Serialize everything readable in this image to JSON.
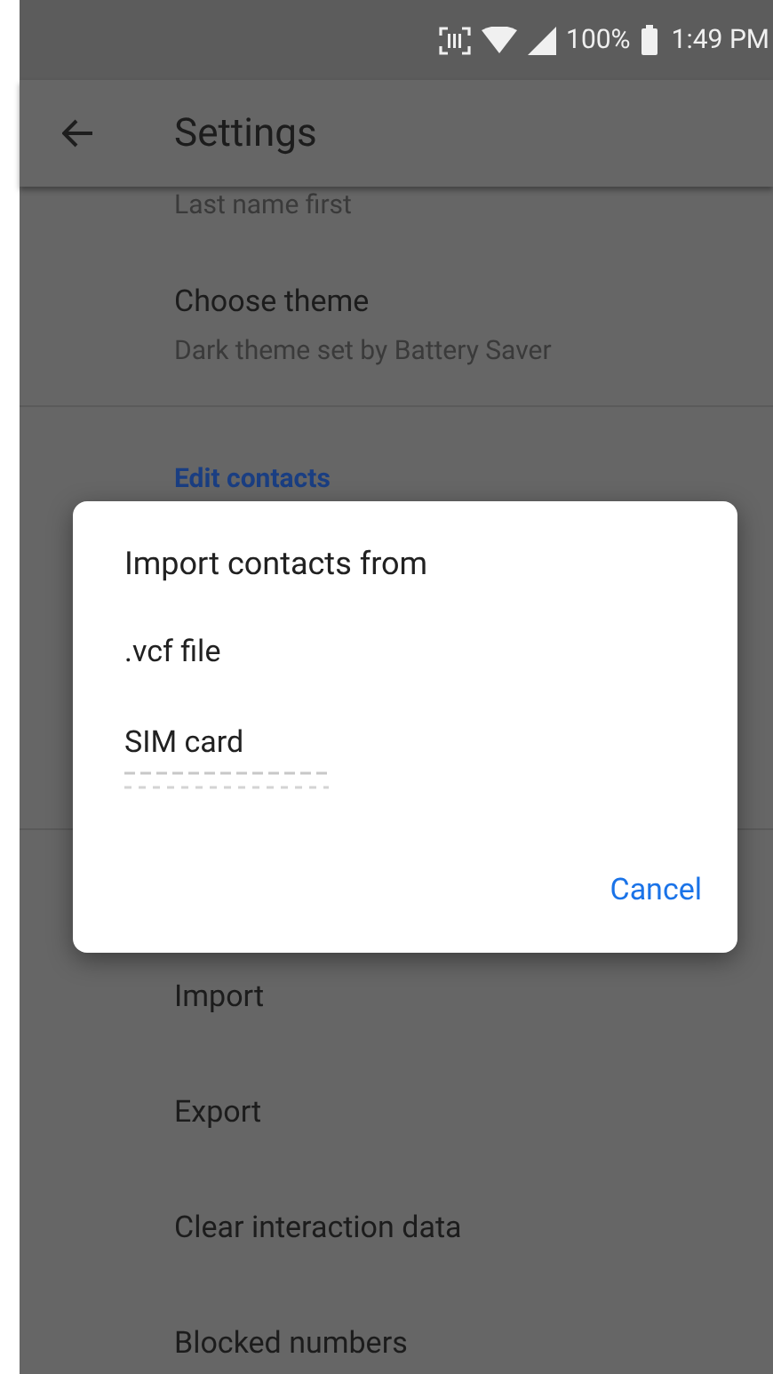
{
  "status_bar": {
    "battery": "100%",
    "time": "1:49 PM"
  },
  "app_bar": {
    "title": "Settings"
  },
  "items": [
    {
      "kind": "cut_setting",
      "title": "Last name first"
    },
    {
      "kind": "setting",
      "title": "Choose theme",
      "subtitle": "Dark theme set by Battery Saver"
    },
    {
      "kind": "divider"
    },
    {
      "kind": "header",
      "title": "Edit contacts"
    },
    {
      "kind": "gap"
    },
    {
      "kind": "divider"
    },
    {
      "kind": "spacer"
    },
    {
      "kind": "setting",
      "title": "Import"
    },
    {
      "kind": "setting",
      "title": "Export"
    },
    {
      "kind": "setting",
      "title": "Clear interaction data"
    },
    {
      "kind": "setting",
      "title": "Blocked numbers"
    }
  ],
  "dialog": {
    "title": "Import contacts from",
    "options": [
      {
        "kind": "plain",
        "label": ".vcf file"
      },
      {
        "kind": "with_hidden_number",
        "label": "SIM card"
      }
    ],
    "button": "Cancel"
  }
}
